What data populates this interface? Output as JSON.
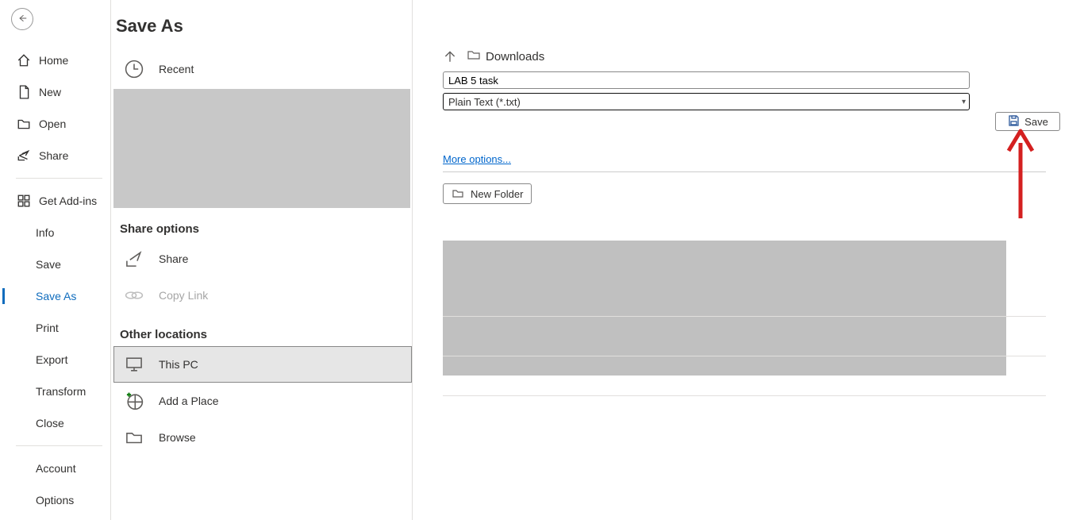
{
  "page_title": "Save As",
  "sidebar": {
    "home": "Home",
    "new": "New",
    "open": "Open",
    "share": "Share",
    "get_addins": "Get Add-ins",
    "info": "Info",
    "save": "Save",
    "save_as": "Save As",
    "print": "Print",
    "export": "Export",
    "transform": "Transform",
    "close": "Close",
    "account": "Account",
    "options": "Options"
  },
  "mid": {
    "recent": "Recent",
    "share_section": "Share options",
    "share": "Share",
    "copy_link": "Copy Link",
    "other_section": "Other locations",
    "this_pc": "This PC",
    "add_place": "Add a Place",
    "browse": "Browse"
  },
  "right": {
    "location": "Downloads",
    "filename": "LAB 5 task",
    "filetype": "Plain Text (*.txt)",
    "save_label": "Save",
    "more_options": "More options...",
    "new_folder": "New Folder"
  }
}
